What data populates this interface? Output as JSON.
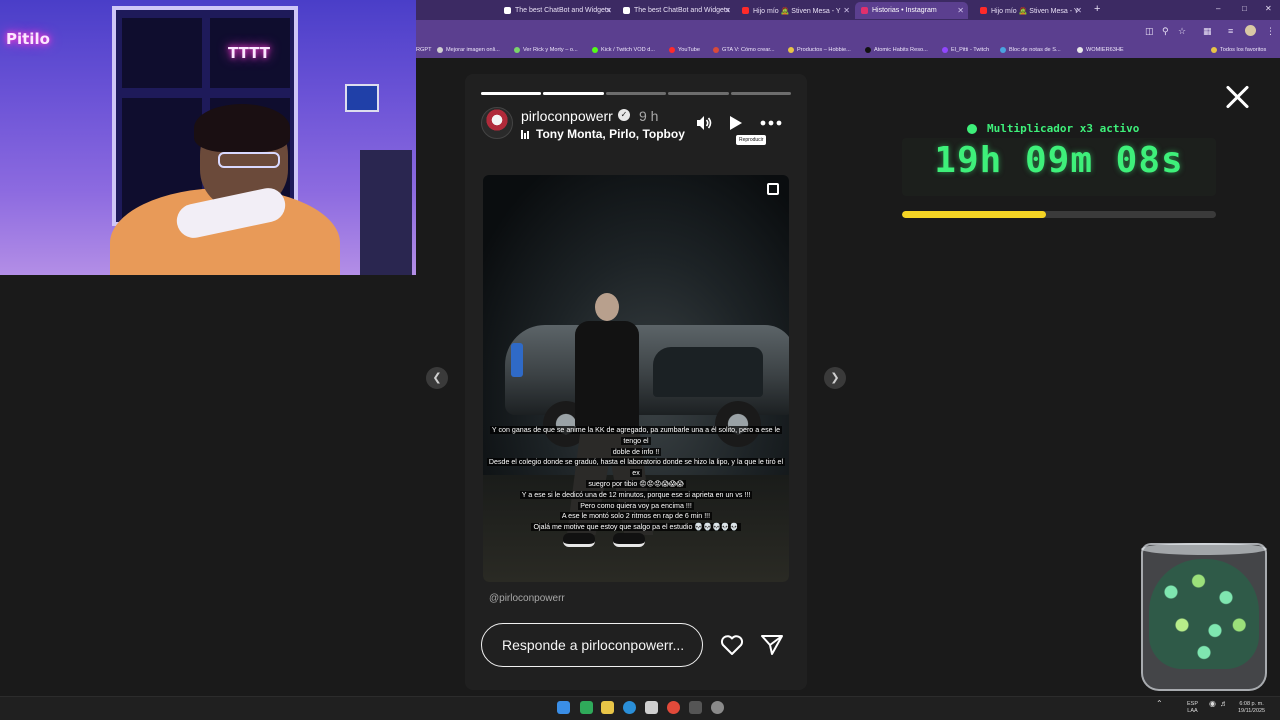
{
  "browser": {
    "tabs": [
      {
        "title": "The best ChatBot and Widgets",
        "favicon_color": "#ffffff",
        "active": false
      },
      {
        "title": "The best ChatBot and Widgets",
        "favicon_color": "#ffffff",
        "active": false
      },
      {
        "title": "Hijo mío 🧟 Stiven Mesa - Y",
        "favicon_color": "#ff2a2a",
        "active": false
      },
      {
        "title": "Historias • Instagram",
        "favicon_color": "#e1306c",
        "active": true
      },
      {
        "title": "Hijo mío 🧟 Stiven Mesa - Y",
        "favicon_color": "#ff2a2a",
        "active": false
      }
    ],
    "bookmarks": [
      {
        "label": "RGPT",
        "color": "#9c9c9c"
      },
      {
        "label": "Mejorar imagen onli...",
        "color": "#cfcfcf"
      },
      {
        "label": "Ver Rick y Morty – o...",
        "color": "#7ad36b"
      },
      {
        "label": "Kick / Twitch VOD d...",
        "color": "#53fc18"
      },
      {
        "label": "YouTube",
        "color": "#ff2a2a"
      },
      {
        "label": "GTA V: Cómo crear...",
        "color": "#d94a3a"
      },
      {
        "label": "Productos – Hobbie...",
        "color": "#e8c547"
      },
      {
        "label": "Atomic Habits Reso...",
        "color": "#111111"
      },
      {
        "label": "El_Pitti - Twitch",
        "color": "#9146ff"
      },
      {
        "label": "Bloc de notas de S...",
        "color": "#4aa3df"
      },
      {
        "label": "WOMIER63HE",
        "color": "#e8e8e8"
      },
      {
        "label": "Todos los favoritos",
        "color": "#e8c547"
      }
    ]
  },
  "webcam": {
    "neon_left": "Pitilo",
    "neon_right": "TTTT"
  },
  "story": {
    "username": "pirloconpowerr",
    "time_ago": "9 h",
    "music": "Tony Monta, Pirlo, Topboy",
    "tooltip": "Reproducir",
    "progress_segments": [
      1,
      1,
      0,
      0,
      0
    ],
    "progress_current": 2,
    "caption_lines": [
      "Y con ganas de que se anime la KK de agregado, pa zumbarle una a él solito, pero a ese le tengo el",
      "doble de info !!",
      "Desde el colegio donde se graduó, hasta el laboratorio donde se hizo la lipo, y la que le tiró el ex",
      "suegro por tibio 😡😡😡😱😱😱",
      "Y a ese si le dedicó una de 12 minutos, porque ese si aprieta en un vs !!!",
      "Pero como quiera voy pa encima !!!",
      "A ese le montó solo 2 ritmos en rap de 6 min !!!",
      "Ojalá me motive que estoy que salgo pa el estudio 💀💀💀💀💀"
    ],
    "mention": "@pirloconpowerr",
    "reply_placeholder": "Responde a pirloconpowerr..."
  },
  "widget": {
    "multiplier_text": "Multiplicador x3 activo",
    "timer_text": "19h 09m 08s",
    "progress_fraction": 0.46,
    "accent_color": "#3ef07a",
    "bar_color": "#f5d424"
  },
  "taskbar": {
    "lang_top": "ESP",
    "lang_bottom": "LAA",
    "time": "6:08 p. m.",
    "date": "19/11/2025"
  },
  "icons": [
    "close-icon",
    "volume-icon",
    "play-icon",
    "more-icon",
    "heart-icon",
    "send-icon",
    "chevron-left-icon",
    "chevron-right-icon",
    "multi-media-icon",
    "verified-icon"
  ]
}
